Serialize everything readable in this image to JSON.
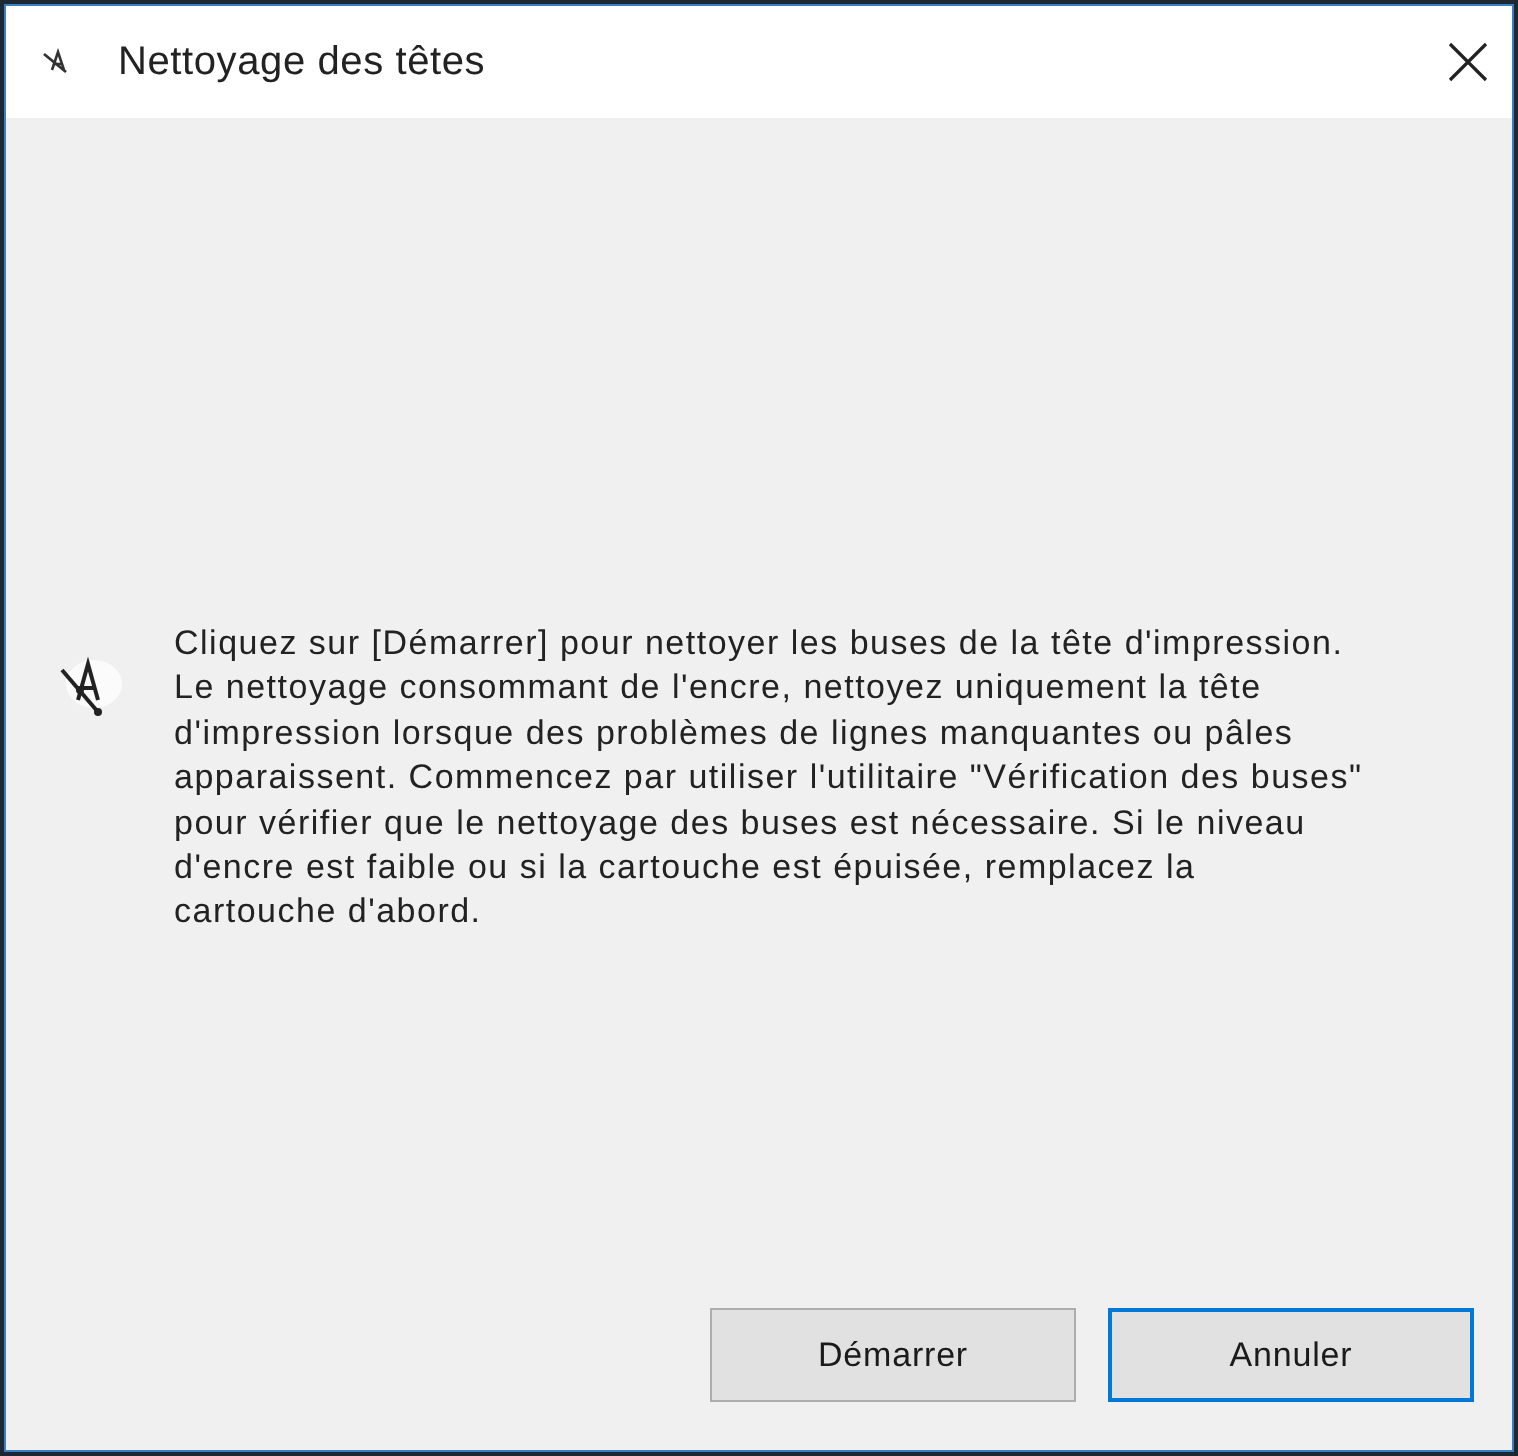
{
  "window": {
    "title": "Nettoyage des têtes"
  },
  "message": {
    "text": "Cliquez sur [Démarrer] pour nettoyer les buses de la tête d'impression.\nLe nettoyage consommant de l'encre, nettoyez uniquement la tête\nd'impression lorsque des problèmes de lignes manquantes ou pâles\napparaissent. Commencez par utiliser l'utilitaire \"Vérification des buses\"\npour vérifier que le nettoyage des buses est nécessaire. Si le niveau\nd'encre est faible ou si la cartouche est épuisée, remplacez la\ncartouche d'abord."
  },
  "buttons": [
    {
      "label": "Démarrer",
      "focused": false
    },
    {
      "label": "Annuler",
      "focused": true
    }
  ]
}
